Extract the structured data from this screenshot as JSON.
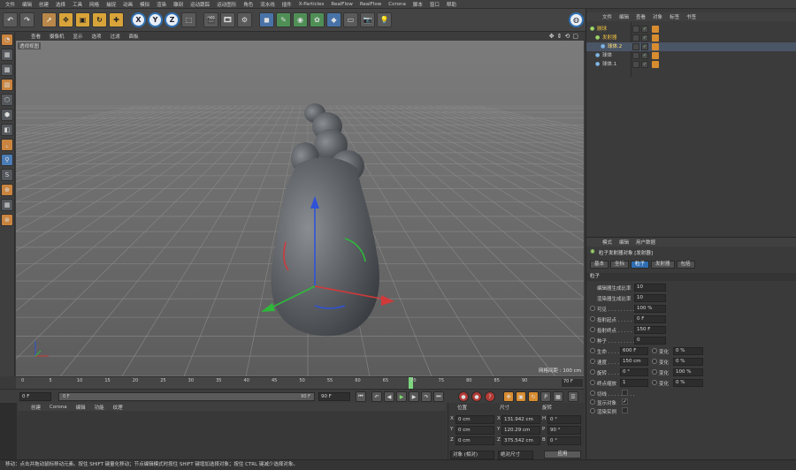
{
  "menu": [
    "文件",
    "编辑",
    "创建",
    "选择",
    "工具",
    "网格",
    "捕捉",
    "动画",
    "模拟",
    "渲染",
    "雕刻",
    "运动跟踪",
    "运动图形",
    "角色",
    "流水线",
    "插件",
    "X-Particles",
    "RealFlow",
    "RealFlow",
    "Corona",
    "脚本",
    "窗口",
    "帮助"
  ],
  "toolbar": {
    "axis_x": "X",
    "axis_y": "Y",
    "axis_z": "Z"
  },
  "viewport": {
    "menu": [
      "查看",
      "摄像机",
      "显示",
      "选项",
      "过滤",
      "面板"
    ],
    "name": "透视视图",
    "grid_info": "网格间距 : 100 cm"
  },
  "timeline": {
    "ticks": [
      "0",
      "5",
      "10",
      "15",
      "20",
      "25",
      "30",
      "35",
      "40",
      "45",
      "50",
      "55",
      "60",
      "65",
      "70",
      "75",
      "80",
      "85",
      "90"
    ],
    "current_frame": "70 F",
    "current_value": 70,
    "max": 90
  },
  "transport": {
    "start": "0 F",
    "slider_left": "0 F",
    "slider_right": "90 F",
    "end": "90 F"
  },
  "material": {
    "tabs": [
      "创建",
      "Corona",
      "编辑",
      "功能",
      "纹理"
    ]
  },
  "coords": {
    "headers": [
      "位置",
      "尺寸",
      "旋转"
    ],
    "rows": [
      {
        "axis": "X",
        "pos": "0 cm",
        "size": "131.942 cm",
        "rot_label": "H",
        "rot": "0 °"
      },
      {
        "axis": "Y",
        "pos": "0 cm",
        "size": "120.29 cm",
        "rot_label": "P",
        "rot": "90 °"
      },
      {
        "axis": "Z",
        "pos": "0 cm",
        "size": "375.542 cm",
        "rot_label": "B",
        "rot": "0 °"
      }
    ],
    "mode": "对象 (相对)",
    "size_mode": "绝对尺寸",
    "apply": "应用"
  },
  "status": "移动：点击并拖动鼠标移动元素。按住 SHIFT 键量化移动；节点编辑模式时按住 SHIFT 键增加选择对象；按住 CTRL 键减少选择对象。",
  "objects": {
    "tabs": [
      "文件",
      "编辑",
      "查看",
      "对象",
      "标签",
      "书签"
    ],
    "items": [
      {
        "name": "融球",
        "indent": 0
      },
      {
        "name": "发射器",
        "indent": 1
      },
      {
        "name": "球体.2",
        "indent": 2
      },
      {
        "name": "球体",
        "indent": 1
      },
      {
        "name": "球体.1",
        "indent": 1
      }
    ]
  },
  "attributes": {
    "tabs_top": [
      "模式",
      "编辑",
      "用户数据"
    ],
    "title": "粒子发射器对象 [发射器]",
    "tabs": [
      "基本",
      "坐标",
      "粒子",
      "发射器",
      "包括"
    ],
    "active_tab": "粒子",
    "section": "粒子",
    "rows": [
      {
        "label": "编辑器生成比率",
        "value": "10"
      },
      {
        "label": "渲染器生成比率",
        "value": "10"
      },
      {
        "label": "可见 . . . . . . . . .",
        "value": "100 %"
      },
      {
        "label": "投射起点 . . . . . .",
        "value": "0 F"
      },
      {
        "label": "投射终点 . . . . . .",
        "value": "150 F"
      },
      {
        "label": "种子 . . . . . . . . .",
        "value": "0"
      }
    ],
    "pairs": [
      {
        "label": "生命 . . . . .",
        "value": "600 F",
        "vlabel": "变化",
        "var": "0 %"
      },
      {
        "label": "速度 . . . . .",
        "value": "150 cm",
        "vlabel": "变化",
        "var": "0 %"
      },
      {
        "label": "旋转 . . . . .",
        "value": "0 °",
        "vlabel": "变化",
        "var": "100 %"
      },
      {
        "label": "终点缩放",
        "value": "1",
        "vlabel": "变化",
        "var": "0 %"
      }
    ],
    "checks": [
      {
        "label": "切线 . . . . . . . . .",
        "checked": ""
      },
      {
        "label": "显示对象",
        "checked": "✓"
      },
      {
        "label": "渲染实例",
        "checked": ""
      }
    ]
  }
}
